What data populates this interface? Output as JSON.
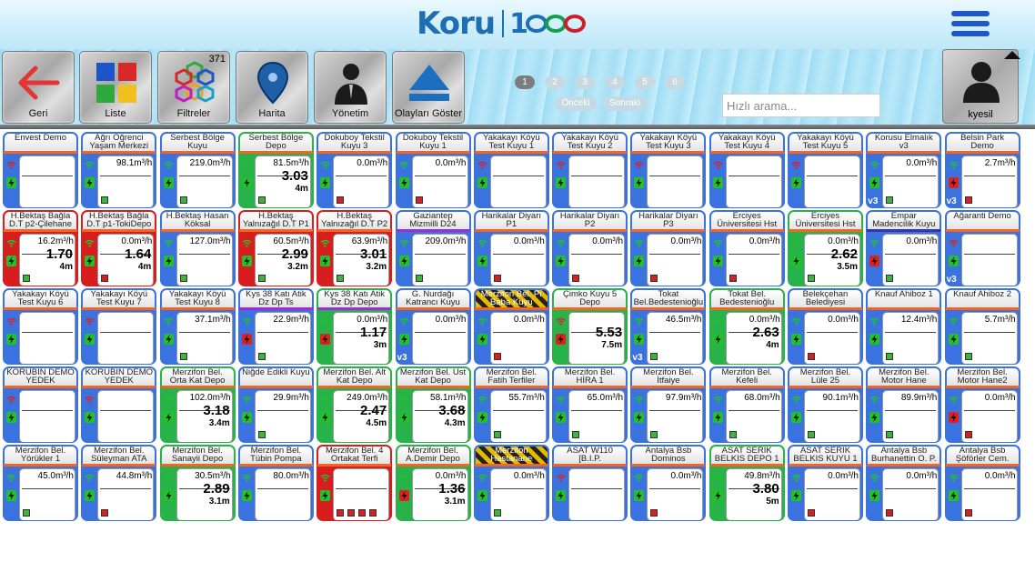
{
  "header": {
    "logo_text": "Koru",
    "logo_number": "1"
  },
  "toolbar": {
    "back_label": "Geri",
    "list_label": "Liste",
    "filter_label": "Filtreler",
    "filter_count": "371",
    "map_label": "Harita",
    "admin_label": "Yönetim",
    "events_label": "Olayları Göster",
    "user_label": "kyesil"
  },
  "pager": {
    "pages": [
      "1",
      "2",
      "3",
      "4",
      "5",
      "6"
    ],
    "active": 0,
    "prev_label": "Önceki",
    "next_label": "Sonraki"
  },
  "search": {
    "placeholder": "Hızlı arama...",
    "value": ""
  },
  "colors": {
    "blue": "#3a73e0",
    "green": "#28b24a",
    "red": "#d71d1d",
    "purple": "#9b2fd0",
    "orange_stripe": "#f26522",
    "navy": "#3535a8"
  },
  "tiles": [
    {
      "title": "Envest Demo",
      "flow": "",
      "total": "",
      "level": "",
      "side": "blue",
      "wifi": "r",
      "bat": "g",
      "ind": [],
      "ver": ""
    },
    {
      "title": "Ağrı Öğrenci\nYaşam Merkezi",
      "flow": "98.1m³/h",
      "total": "",
      "level": "",
      "side": "blue",
      "wifi": "g",
      "bat": "g",
      "ind": [
        "g"
      ],
      "ver": ""
    },
    {
      "title": "Serbest Bölge\nKuyu",
      "flow": "219.0m³/h",
      "total": "",
      "level": "",
      "side": "blue",
      "wifi": "g",
      "bat": "g",
      "ind": [
        "g"
      ],
      "ver": ""
    },
    {
      "title": "Serbest Bölge\nDepo",
      "flow": "81.5m³/h",
      "total": "3.03",
      "level": "4m",
      "side": "green",
      "wifi": "g",
      "bat": "g",
      "ind": [
        "g"
      ],
      "ver": ""
    },
    {
      "title": "Dokuboy Tekstil\nKuyu 3",
      "flow": "0.0m³/h",
      "total": "",
      "level": "",
      "side": "blue",
      "wifi": "g",
      "bat": "g",
      "ind": [
        "r"
      ],
      "ver": ""
    },
    {
      "title": "Dokuboy Tekstil\nKuyu 1",
      "flow": "0.0m³/h",
      "total": "",
      "level": "",
      "side": "blue",
      "wifi": "g",
      "bat": "g",
      "ind": [
        "r"
      ],
      "ver": ""
    },
    {
      "title": "Yakakayı Köyü\nTest Kuyu 1",
      "flow": "",
      "total": "",
      "level": "",
      "side": "blue",
      "wifi": "r",
      "bat": "g",
      "ind": [],
      "ver": ""
    },
    {
      "title": "Yakakayı Köyü\nTest Kuyu 2",
      "flow": "",
      "total": "",
      "level": "",
      "side": "blue",
      "wifi": "r",
      "bat": "g",
      "ind": [],
      "ver": ""
    },
    {
      "title": "Yakakayı Köyü\nTest Kuyu 3",
      "flow": "",
      "total": "",
      "level": "",
      "side": "blue",
      "wifi": "r",
      "bat": "g",
      "ind": [],
      "ver": ""
    },
    {
      "title": "Yakakayı Köyü\nTest Kuyu 4",
      "flow": "",
      "total": "",
      "level": "",
      "side": "blue",
      "wifi": "r",
      "bat": "g",
      "ind": [],
      "ver": ""
    },
    {
      "title": "Yakakayı Köyü\nTest Kuyu 5",
      "flow": "",
      "total": "",
      "level": "",
      "side": "blue",
      "wifi": "r",
      "bat": "g",
      "ind": [],
      "ver": ""
    },
    {
      "title": "Korusu Elmalık\nv3",
      "flow": "0.0m³/h",
      "total": "",
      "level": "",
      "side": "blue",
      "wifi": "g",
      "bat": "g",
      "ind": [
        "g"
      ],
      "ver": "v3"
    },
    {
      "title": "Belsin Park\nDemo",
      "flow": "2.7m³/h",
      "total": "",
      "level": "",
      "side": "blue",
      "wifi": "g",
      "bat": "r",
      "ind": [
        "r"
      ],
      "ver": "v3"
    },
    {
      "title": "H.Bektaş Bağla\nD.T p2-Çilehane",
      "flow": "16.2m³/h",
      "total": "1.70",
      "level": "4m",
      "side": "red",
      "wifi": "g",
      "bat": "g",
      "ind": [
        "g"
      ],
      "ver": ""
    },
    {
      "title": "H.Bektaş Bağla\nD.T p1-TokiDepo",
      "flow": "0.0m³/h",
      "total": "1.64",
      "level": "4m",
      "side": "red",
      "wifi": "g",
      "bat": "g",
      "ind": [
        "r"
      ],
      "ver": ""
    },
    {
      "title": "H.Bektaş Hasan\nKöksal",
      "flow": "127.0m³/h",
      "total": "",
      "level": "",
      "side": "blue",
      "wifi": "g",
      "bat": "g",
      "ind": [
        "g"
      ],
      "ver": ""
    },
    {
      "title": "H.Bektaş\nYalnızağıl D.T P1",
      "flow": "60.5m³/h",
      "total": "2.99",
      "level": "3.2m",
      "side": "red",
      "wifi": "g",
      "bat": "g",
      "ind": [
        "g"
      ],
      "ver": ""
    },
    {
      "title": "H.Bektaş\nYalnızağıl D.T P2",
      "flow": "63.9m³/h",
      "total": "3.01",
      "level": "3.2m",
      "side": "red",
      "wifi": "g",
      "bat": "g",
      "ind": [
        "g"
      ],
      "ver": ""
    },
    {
      "title": "Gaziantep\nMizmilli D24",
      "flow": "209.0m³/h",
      "total": "",
      "level": "",
      "side": "blue",
      "wifi": "g",
      "bat": "g",
      "ind": [
        "g"
      ],
      "ver": "",
      "stripe": "purple"
    },
    {
      "title": "Harikalar Diyarı\nP1",
      "flow": "0.0m³/h",
      "total": "",
      "level": "",
      "side": "blue",
      "wifi": "g",
      "bat": "g",
      "ind": [
        "r"
      ],
      "ver": ""
    },
    {
      "title": "Harikalar Diyarı\nP2",
      "flow": "0.0m³/h",
      "total": "",
      "level": "",
      "side": "blue",
      "wifi": "g",
      "bat": "g",
      "ind": [
        "r"
      ],
      "ver": ""
    },
    {
      "title": "Harikalar Diyarı\nP3",
      "flow": "0.0m³/h",
      "total": "",
      "level": "",
      "side": "blue",
      "wifi": "g",
      "bat": "g",
      "ind": [
        "r"
      ],
      "ver": ""
    },
    {
      "title": "Erciyes\nÜniversitesi Hst",
      "flow": "0.0m³/h",
      "total": "",
      "level": "",
      "side": "blue",
      "wifi": "g",
      "bat": "g",
      "ind": [
        "r"
      ],
      "ver": ""
    },
    {
      "title": "Erciyes\nÜniversitesi Hst",
      "flow": "0.0m³/h",
      "total": "2.62",
      "level": "3.5m",
      "side": "green",
      "wifi": "g",
      "bat": "g",
      "ind": [
        "g"
      ],
      "ver": ""
    },
    {
      "title": "Empar\nMadencilik Kuyu",
      "flow": "0.0m³/h",
      "total": "",
      "level": "",
      "side": "blue",
      "wifi": "g",
      "bat": "r",
      "ind": [
        "g"
      ],
      "ver": "",
      "stripe": "navy"
    },
    {
      "title": "Ağaranti Demo",
      "flow": "",
      "total": "",
      "level": "",
      "side": "blue",
      "wifi": "r",
      "bat": "g",
      "ind": [],
      "ver": "v3"
    },
    {
      "title": "Yakakayı Köyü\nTest Kuyu 6",
      "flow": "",
      "total": "",
      "level": "",
      "side": "blue",
      "wifi": "r",
      "bat": "g",
      "ind": [],
      "ver": ""
    },
    {
      "title": "Yakakayı Köyü\nTest Kuyu 7",
      "flow": "",
      "total": "",
      "level": "",
      "side": "blue",
      "wifi": "r",
      "bat": "g",
      "ind": [],
      "ver": ""
    },
    {
      "title": "Yakakayı Köyü\nTest Kuyu 8",
      "flow": "37.1m³/h",
      "total": "",
      "level": "",
      "side": "blue",
      "wifi": "g",
      "bat": "g",
      "ind": [
        "g"
      ],
      "ver": ""
    },
    {
      "title": "Kys 38 Katı Atik\nDz Dp Ts",
      "flow": "22.9m³/h",
      "total": "",
      "level": "",
      "side": "blue",
      "wifi": "g",
      "bat": "r",
      "ind": [
        "g"
      ],
      "ver": "",
      "stripe": "purple"
    },
    {
      "title": "Kys 38 Katı Atik\nDz Dp Depo",
      "flow": "0.0m³/h",
      "total": "1.17",
      "level": "3m",
      "side": "green",
      "wifi": "g",
      "bat": "r",
      "ind": [],
      "ver": "",
      "stripe": "purple"
    },
    {
      "title": "G. Nurdağı\nKatrancı Kuyu",
      "flow": "0.0m³/h",
      "total": "",
      "level": "",
      "side": "blue",
      "wifi": "g",
      "bat": "g",
      "ind": [],
      "ver": "v3"
    },
    {
      "title": "Merzifon Bel. Pı\nBaba Kuyu",
      "flow": "0.0m³/h",
      "total": "",
      "level": "",
      "side": "blue",
      "wifi": "g",
      "bat": "g",
      "ind": [
        "r"
      ],
      "ver": "",
      "hazard": true
    },
    {
      "title": "Çimko Kuyu 5\nDepo",
      "flow": "",
      "total": "5.53",
      "level": "7.5m",
      "side": "green",
      "wifi": "r",
      "bat": "r",
      "ind": [],
      "ver": ""
    },
    {
      "title": "Tokat\nBel.Bedestenioğlu",
      "flow": "46.5m³/h",
      "total": "",
      "level": "",
      "side": "blue",
      "wifi": "g",
      "bat": "g",
      "ind": [
        "g"
      ],
      "ver": "v3"
    },
    {
      "title": "Tokat Bel.\nBedestenioğlu",
      "flow": "0.0m³/h",
      "total": "2.63",
      "level": "4m",
      "side": "green",
      "wifi": "g",
      "bat": "g",
      "ind": [],
      "ver": ""
    },
    {
      "title": "Belekçehan\nBelediyesi",
      "flow": "0.0m³/h",
      "total": "",
      "level": "",
      "side": "blue",
      "wifi": "g",
      "bat": "g",
      "ind": [
        "r"
      ],
      "ver": ""
    },
    {
      "title": "Knauf Ahiboz 1",
      "flow": "12.4m³/h",
      "total": "",
      "level": "",
      "side": "blue",
      "wifi": "g",
      "bat": "g",
      "ind": [
        "g"
      ],
      "ver": ""
    },
    {
      "title": "Knauf Ahiboz 2",
      "flow": "5.7m³/h",
      "total": "",
      "level": "",
      "side": "blue",
      "wifi": "g",
      "bat": "g",
      "ind": [
        "g"
      ],
      "ver": ""
    },
    {
      "title": "KORUBİN DEMO\nYEDEK",
      "flow": "",
      "total": "",
      "level": "",
      "side": "blue",
      "wifi": "r",
      "bat": "g",
      "ind": [],
      "ver": ""
    },
    {
      "title": "KORUBİN DEMO\nYEDEK",
      "flow": "",
      "total": "",
      "level": "",
      "side": "blue",
      "wifi": "r",
      "bat": "g",
      "ind": [],
      "ver": ""
    },
    {
      "title": "Merzifon Bel.\nOrta Kat Depo",
      "flow": "102.0m³/h",
      "total": "3.18",
      "level": "3.4m",
      "side": "green",
      "wifi": "g",
      "bat": "g",
      "ind": [],
      "ver": ""
    },
    {
      "title": "Niğde Edikli Kuyu",
      "flow": "29.9m³/h",
      "total": "",
      "level": "",
      "side": "blue",
      "wifi": "g",
      "bat": "g",
      "ind": [
        "g"
      ],
      "ver": ""
    },
    {
      "title": "Merzifon Bel. Alt\nKat Depo",
      "flow": "249.0m³/h",
      "total": "2.47",
      "level": "4.5m",
      "side": "green",
      "wifi": "g",
      "bat": "g",
      "ind": [],
      "ver": ""
    },
    {
      "title": "Merzifon Bel. Üst\nKat Depo",
      "flow": "58.1m³/h",
      "total": "3.68",
      "level": "4.3m",
      "side": "green",
      "wifi": "g",
      "bat": "g",
      "ind": [],
      "ver": ""
    },
    {
      "title": "Merzifon Bel.\nFatih Terfiler",
      "flow": "55.7m³/h",
      "total": "",
      "level": "",
      "side": "blue",
      "wifi": "g",
      "bat": "g",
      "ind": [
        "g"
      ],
      "ver": ""
    },
    {
      "title": "Merzifon Bel.\nHİRA 1",
      "flow": "65.0m³/h",
      "total": "",
      "level": "",
      "side": "blue",
      "wifi": "g",
      "bat": "g",
      "ind": [
        "g"
      ],
      "ver": ""
    },
    {
      "title": "Merzifon Bel.\nİtfaiye",
      "flow": "97.9m³/h",
      "total": "",
      "level": "",
      "side": "blue",
      "wifi": "g",
      "bat": "g",
      "ind": [
        "g"
      ],
      "ver": ""
    },
    {
      "title": "Merzifon Bel.\nKefeli",
      "flow": "68.0m³/h",
      "total": "",
      "level": "",
      "side": "blue",
      "wifi": "g",
      "bat": "g",
      "ind": [
        "g"
      ],
      "ver": ""
    },
    {
      "title": "Merzifon Bel.\nLüle 25",
      "flow": "90.1m³/h",
      "total": "",
      "level": "",
      "side": "blue",
      "wifi": "g",
      "bat": "g",
      "ind": [
        "g"
      ],
      "ver": ""
    },
    {
      "title": "Merzifon Bel.\nMotor Hane",
      "flow": "89.9m³/h",
      "total": "",
      "level": "",
      "side": "blue",
      "wifi": "g",
      "bat": "g",
      "ind": [
        "g"
      ],
      "ver": ""
    },
    {
      "title": "Merzifon Bel.\nMotor Hane2",
      "flow": "0.0m³/h",
      "total": "",
      "level": "",
      "side": "blue",
      "wifi": "g",
      "bat": "r",
      "ind": [
        "r"
      ],
      "ver": ""
    },
    {
      "title": "Merzifon Bel.\nYörükler 1",
      "flow": "45.0m³/h",
      "total": "",
      "level": "",
      "side": "blue",
      "wifi": "g",
      "bat": "g",
      "ind": [
        "g"
      ],
      "ver": ""
    },
    {
      "title": "Merzifon Bel.\nSüleyman ATA",
      "flow": "44.8m³/h",
      "total": "",
      "level": "",
      "side": "blue",
      "wifi": "g",
      "bat": "g",
      "ind": [
        "r"
      ],
      "ver": ""
    },
    {
      "title": "Merzifon Bel.\nSanayii Depo",
      "flow": "30.5m³/h",
      "total": "2.89",
      "level": "3.1m",
      "side": "green",
      "wifi": "g",
      "bat": "g",
      "ind": [],
      "ver": ""
    },
    {
      "title": "Merzifon Bel.\nTübin Pompa",
      "flow": "80.0m³/h",
      "total": "",
      "level": "",
      "side": "blue",
      "wifi": "g",
      "bat": "g",
      "ind": [],
      "ver": ""
    },
    {
      "title": "Merzifon Bel. 4\nOrtakat Terfi",
      "flow": "",
      "total": "",
      "level": "",
      "side": "red",
      "wifi": "g",
      "bat": "g",
      "ind": [
        "r",
        "r",
        "r",
        "r"
      ],
      "ver": ""
    },
    {
      "title": "Merzifon Bel.\nA.Demir Depo",
      "flow": "0.0m³/h",
      "total": "1.36",
      "level": "3.1m",
      "side": "green",
      "wifi": "g",
      "bat": "r",
      "ind": [],
      "ver": ""
    },
    {
      "title": "Merzifon\nHastanane",
      "flow": "0.0m³/h",
      "total": "",
      "level": "",
      "side": "blue",
      "wifi": "g",
      "bat": "g",
      "ind": [
        "g"
      ],
      "ver": "",
      "hazard": true
    },
    {
      "title": "ASAT W110\n[B.I.P.",
      "flow": "",
      "total": "",
      "level": "",
      "side": "blue",
      "wifi": "r",
      "bat": "g",
      "ind": [],
      "ver": ""
    },
    {
      "title": "Antalya Bsb\nDominos",
      "flow": "0.0m³/h",
      "total": "",
      "level": "",
      "side": "blue",
      "wifi": "g",
      "bat": "g",
      "ind": [
        "r"
      ],
      "ver": ""
    },
    {
      "title": "ASAT SERIK\nBELKIS DEPO 1",
      "flow": "49.8m³/h",
      "total": "3.80",
      "level": "5m",
      "side": "green",
      "wifi": "g",
      "bat": "g",
      "ind": [],
      "ver": ""
    },
    {
      "title": "ASAT SERIK\nBELKIS KUYU 1",
      "flow": "0.0m³/h",
      "total": "",
      "level": "",
      "side": "blue",
      "wifi": "g",
      "bat": "g",
      "ind": [
        "r"
      ],
      "ver": ""
    },
    {
      "title": "Antalya Bsb\nBurhanettin O. P.",
      "flow": "0.0m³/h",
      "total": "",
      "level": "",
      "side": "blue",
      "wifi": "g",
      "bat": "g",
      "ind": [
        "r"
      ],
      "ver": ""
    },
    {
      "title": "Antalya Bsb\nŞöförler Cem.",
      "flow": "0.0m³/h",
      "total": "",
      "level": "",
      "side": "blue",
      "wifi": "g",
      "bat": "g",
      "ind": [
        "r"
      ],
      "ver": ""
    }
  ]
}
